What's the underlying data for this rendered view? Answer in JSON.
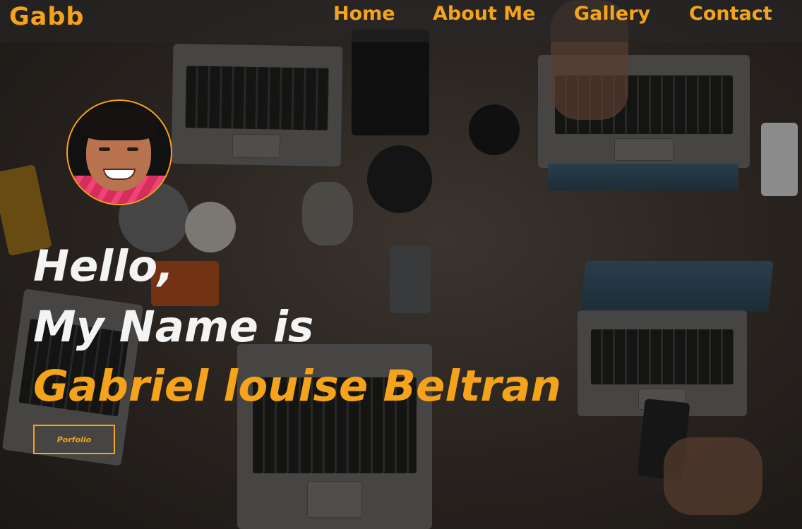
{
  "brand": {
    "name": "Gabb"
  },
  "nav": {
    "items": [
      {
        "label": "Home"
      },
      {
        "label": "About Me"
      },
      {
        "label": "Gallery"
      },
      {
        "label": "Contact"
      }
    ]
  },
  "hero": {
    "greeting": "Hello,",
    "intro": "My Name is",
    "name": "Gabriel louise Beltran",
    "button_label": "Porfolio"
  },
  "colors": {
    "accent": "#f5a31a",
    "text_light": "#f4f4f4"
  },
  "icons": {
    "avatar": "profile-photo"
  }
}
